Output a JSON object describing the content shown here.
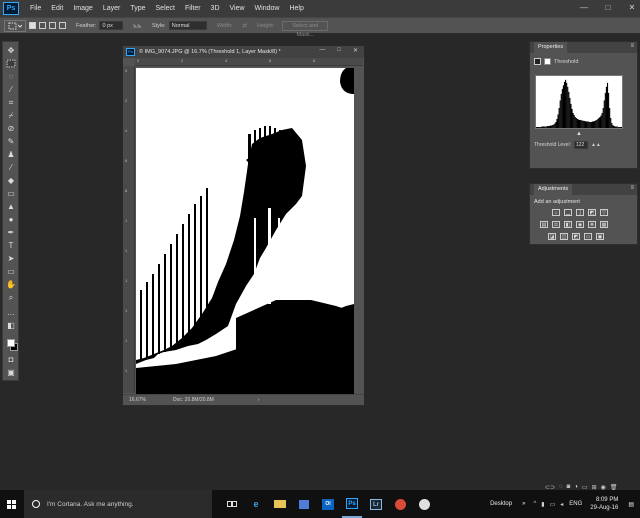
{
  "app": {
    "logo": "Ps"
  },
  "menubar": {
    "items": [
      "File",
      "Edit",
      "Image",
      "Layer",
      "Type",
      "Select",
      "Filter",
      "3D",
      "View",
      "Window",
      "Help"
    ],
    "controls": [
      "—",
      "□",
      "✕"
    ]
  },
  "options": {
    "feather_label": "Feather:",
    "feather_value": "0 px",
    "style_label": "Style:",
    "style_value": "Normal",
    "width_label": "Width:",
    "height_label": "Height:",
    "select_mask_label": "Select and Mask..."
  },
  "document": {
    "title": "© IMG_9074.JPG @ 16.7% (Threshold 1, Layer Mask/8) *",
    "zoom": "16.67%",
    "doc_info": "Doc: 20.8M/20.8M",
    "ruler_top": [
      "0",
      "2",
      "4",
      "6",
      "8"
    ],
    "ruler_left": [
      "0",
      "2",
      "4",
      "6",
      "8",
      "1",
      "1",
      "1",
      "1",
      "1",
      "1"
    ]
  },
  "properties": {
    "tab": "Properties",
    "type_label": "Threshold",
    "threshold_label": "Threshold Level:",
    "threshold_value": "122",
    "histogram": [
      2,
      2,
      2,
      2,
      2,
      3,
      3,
      3,
      3,
      3,
      4,
      4,
      4,
      5,
      5,
      6,
      7,
      9,
      12,
      18,
      27,
      40,
      55,
      68,
      78,
      85,
      92,
      96,
      90,
      82,
      72,
      60,
      48,
      38,
      30,
      26,
      22,
      20,
      18,
      17,
      16,
      16,
      15,
      15,
      14,
      14,
      13,
      13,
      13,
      12,
      12,
      12,
      13,
      13,
      14,
      15,
      16,
      18,
      20,
      22,
      25,
      30,
      40,
      55,
      70,
      82,
      90,
      70,
      40,
      20,
      10,
      6,
      4,
      3,
      3,
      3,
      2,
      2,
      2,
      2
    ]
  },
  "adjustments": {
    "tab": "Adjustments",
    "subtitle": "Add an adjustment"
  },
  "taskbar": {
    "cortana_text": "I'm Cortana. Ask me anything.",
    "apps": [
      "e",
      "",
      "",
      "Ol",
      "Ps",
      "Lr",
      "",
      ""
    ],
    "desktop_label": "Desktop",
    "lang": "ENG",
    "time": "8:09 PM",
    "date": "29-Aug-16"
  },
  "colors": {
    "app_bg": "#282828",
    "panel_bg": "#535353",
    "ps_blue": "#31a8ff",
    "taskbar": "#101010"
  }
}
